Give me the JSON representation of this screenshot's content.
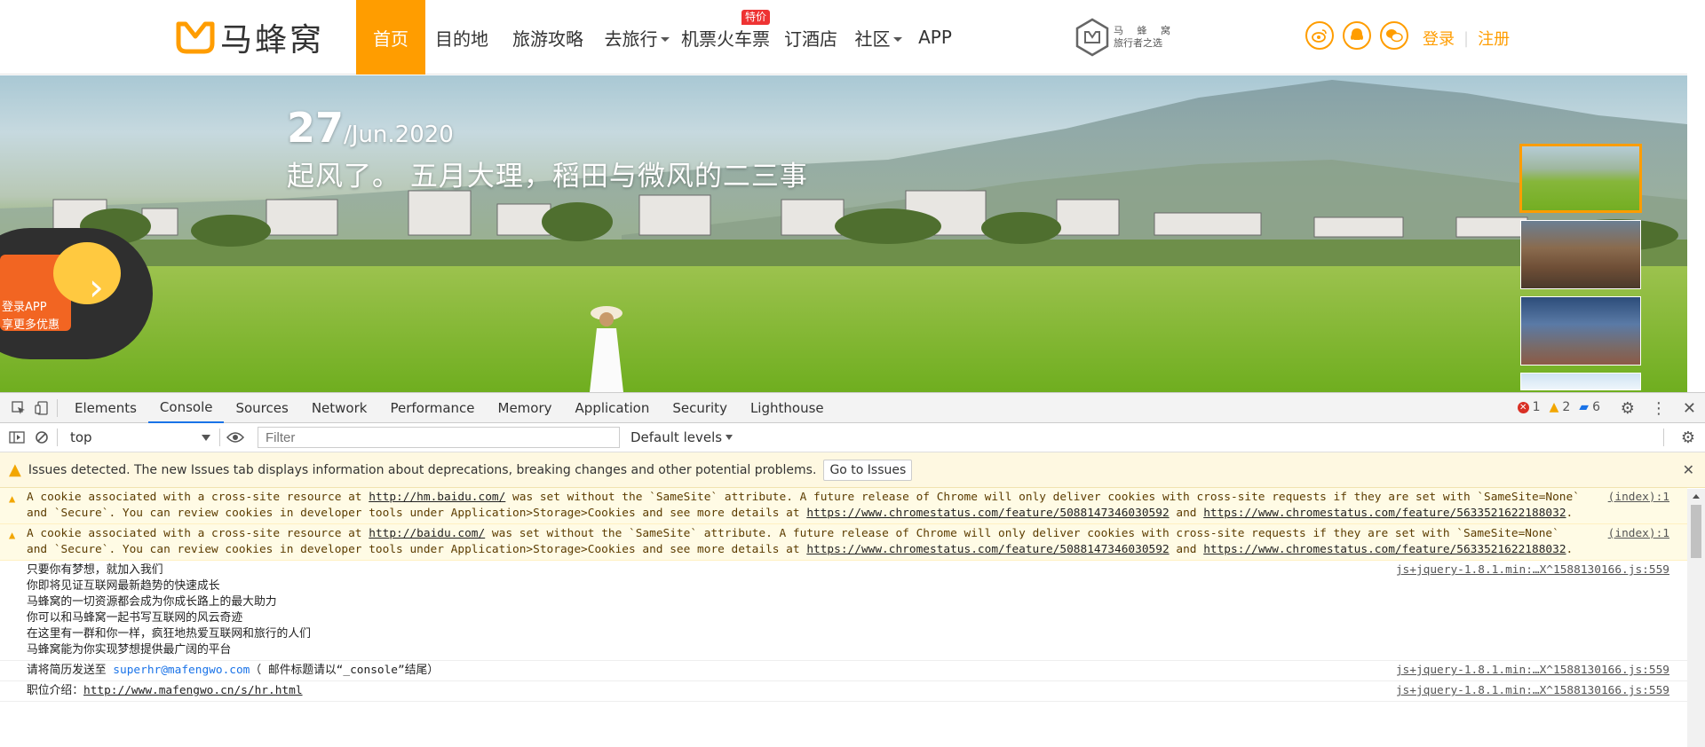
{
  "site": {
    "logo_text": "马蜂窝",
    "nav": [
      {
        "label": "首页",
        "active": true
      },
      {
        "label": "目的地"
      },
      {
        "label": "旅游攻略"
      },
      {
        "label": "去旅行",
        "dropdown": true
      },
      {
        "label": "机票火车票",
        "badge": "特价"
      },
      {
        "label": "订酒店"
      },
      {
        "label": "社区",
        "dropdown": true
      },
      {
        "label": "APP"
      }
    ],
    "brand_line1": "马 蜂 窝",
    "brand_line2": "旅行者之选",
    "social_icons": [
      "weibo-icon",
      "qq-icon",
      "wechat-icon"
    ],
    "login": "登录",
    "register": "注册",
    "accent_color": "#ff9d00"
  },
  "banner": {
    "date_day": "27",
    "date_rest": "/Jun.2020",
    "title": "起风了。 五月大理，稻田与微风的二三事",
    "promo_line1": "登录APP",
    "promo_line2": "享更多优惠",
    "promo_arrow": "›"
  },
  "devtools": {
    "tabs": [
      "Elements",
      "Console",
      "Sources",
      "Network",
      "Performance",
      "Memory",
      "Application",
      "Security",
      "Lighthouse"
    ],
    "active_tab": "Console",
    "counts": {
      "errors": "1",
      "warnings": "2",
      "info": "6"
    },
    "context": "top",
    "filter_placeholder": "Filter",
    "levels": "Default levels",
    "issues_text": "Issues detected. The new Issues tab displays information about deprecations, breaking changes and other potential problems.",
    "issues_button": "Go to Issues",
    "messages": [
      {
        "type": "warn",
        "source": "(index):1",
        "parts": [
          {
            "t": "A cookie associated with a cross-site resource at "
          },
          {
            "t": "http://hm.baidu.com/",
            "link": true
          },
          {
            "t": " was set without the `SameSite` attribute. A future release of Chrome will only deliver cookies with cross-site requests if they are set with `SameSite=None` and `Secure`. You can review cookies in developer tools under Application>Storage>Cookies and see more details at "
          },
          {
            "t": "https://www.chromestatus.com/feature/5088147346030592",
            "link": true
          },
          {
            "t": " and "
          },
          {
            "t": "https://www.chromestatus.com/feature/5633521622188032",
            "link": true
          },
          {
            "t": "."
          }
        ]
      },
      {
        "type": "warn",
        "source": "(index):1",
        "parts": [
          {
            "t": "A cookie associated with a cross-site resource at "
          },
          {
            "t": "http://baidu.com/",
            "link": true
          },
          {
            "t": " was set without the `SameSite` attribute. A future release of Chrome will only deliver cookies with cross-site requests if they are set with `SameSite=None` and `Secure`. You can review cookies in developer tools under Application>Storage>Cookies and see more details at "
          },
          {
            "t": "https://www.chromestatus.com/feature/5088147346030592",
            "link": true
          },
          {
            "t": " and "
          },
          {
            "t": "https://www.chromestatus.com/feature/5633521622188032",
            "link": true
          },
          {
            "t": "."
          }
        ]
      },
      {
        "type": "log",
        "source": "js+jquery-1.8.1.min:…X^1588130166.js:559",
        "lines": [
          "只要你有梦想，就加入我们",
          "你即将见证互联网最新趋势的快速成长",
          "马蜂窝的一切资源都会成为你成长路上的最大助力",
          "你可以和马蜂窝一起书写互联网的风云奇迹",
          "在这里有一群和你一样，疯狂地热爱互联网和旅行的人们",
          "马蜂窝能为你实现梦想提供最广阔的平台"
        ]
      },
      {
        "type": "log",
        "source": "js+jquery-1.8.1.min:…X^1588130166.js:559",
        "parts": [
          {
            "t": "请将简历发送至 "
          },
          {
            "t": "superhr@mafengwo.com",
            "mail": true
          },
          {
            "t": "（ 邮件标题请以“_console”结尾）"
          }
        ]
      },
      {
        "type": "log",
        "source": "js+jquery-1.8.1.min:…X^1588130166.js:559",
        "parts": [
          {
            "t": "职位介绍："
          },
          {
            "t": "http://www.mafengwo.cn/s/hr.html",
            "link": true
          }
        ]
      }
    ]
  }
}
